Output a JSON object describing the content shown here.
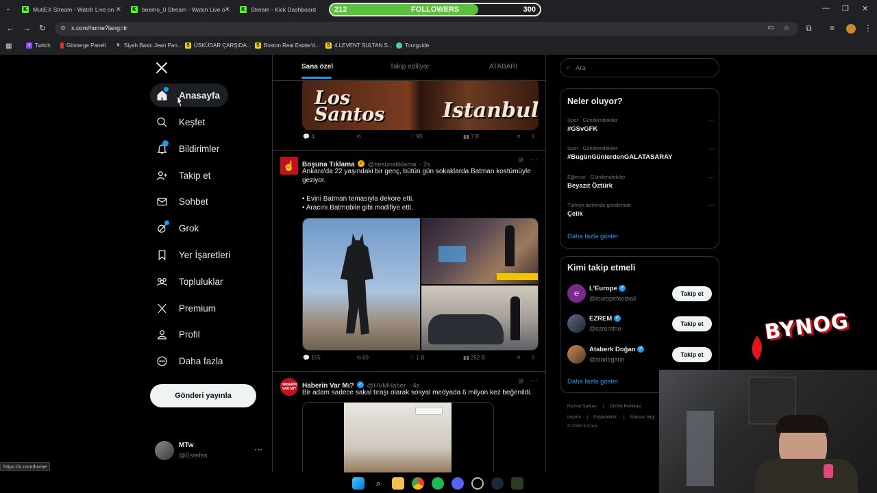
{
  "browser": {
    "tabs": [
      {
        "label": "MutiEX Stream - Watch Live on"
      },
      {
        "label": "beemo_0 Stream - Watch Live o"
      },
      {
        "label": "Stream - Kick Dashboard"
      }
    ],
    "url": "x.com/home?lang=tr",
    "bookmarks": [
      {
        "label": "Twitch"
      },
      {
        "label": "Gösterge Paneli"
      },
      {
        "label": "Siyah Basic Jean Pan..."
      },
      {
        "label": "ÜSKÜDAR ÇARŞIDA..."
      },
      {
        "label": "Boston Real Estate'd..."
      },
      {
        "label": "4.LEVENT SULTAN S..."
      },
      {
        "label": "Tourguide"
      }
    ],
    "status_url": "https://x.com/home"
  },
  "overlay": {
    "followers_current": "212",
    "followers_label": "FOLLOWERS",
    "followers_goal": "300",
    "followers_progress": 0.707,
    "brand_text": "BYNOG"
  },
  "sidebar": {
    "items": [
      {
        "label": "Anasayfa",
        "icon": "home-icon"
      },
      {
        "label": "Keşfet",
        "icon": "search-icon"
      },
      {
        "label": "Bildirimler",
        "icon": "bell-icon"
      },
      {
        "label": "Takip et",
        "icon": "add-user-icon"
      },
      {
        "label": "Sohbet",
        "icon": "mail-icon"
      },
      {
        "label": "Grok",
        "icon": "grok-icon"
      },
      {
        "label": "Yer İşaretleri",
        "icon": "bookmark-icon"
      },
      {
        "label": "Topluluklar",
        "icon": "communities-icon"
      },
      {
        "label": "Premium",
        "icon": "x-logo-icon"
      },
      {
        "label": "Profil",
        "icon": "profile-icon"
      },
      {
        "label": "Daha fazla",
        "icon": "more-icon"
      }
    ],
    "post_button": "Gönderi yayınla",
    "account": {
      "name": "MTw",
      "handle": "@Esrefss"
    }
  },
  "feed": {
    "tabs": [
      "Sana özel",
      "Takip ediliyor",
      "ATABARI"
    ],
    "banner": {
      "left_text": "Los Santos",
      "right_text": "Istanbul"
    },
    "first_actions": {
      "replies": "4",
      "likes": "93",
      "views": "7 B"
    },
    "tweet1": {
      "name": "Boşuna Tıklama",
      "handle": "@bosunatiklama",
      "time": "· 2s",
      "text1": "Ankara'da 22 yaşındaki bir genç, bütün gün sokaklarda Batman kostümüyle geziyor.",
      "bullet1": "• Evini Batman temasıyla dekore etti.",
      "bullet2": "• Aracını Batmobile gibi modifiye etti.",
      "replies": "155",
      "reposts": "60",
      "likes": "1 B",
      "views": "252 B"
    },
    "tweet2": {
      "name": "Haberin Var Mı?",
      "handle": "@HVMHaber",
      "time": "· 4s",
      "text": "Bir adam sadece sakal tıraşı olarak sosyal medyada 6 milyon kez beğenildi.",
      "avatar_text": "HABERİN VAR MI?"
    }
  },
  "right": {
    "search_placeholder": "Ara",
    "trends_title": "Neler oluyor?",
    "trends": [
      {
        "category": "Spor · Gündemdekiler",
        "name": "#GSvGFK"
      },
      {
        "category": "Spor · Gündemdekiler",
        "name": "#BugünGünlerdenGALATASARAY"
      },
      {
        "category": "Eğlence · Gündemdekiler",
        "name": "Beyazıt Öztürk"
      },
      {
        "category": "Türkiye tarihinde gündemde",
        "name": "Çelik"
      }
    ],
    "trends_more": "Daha fazla göster",
    "who_title": "Kimi takip etmeli",
    "who": [
      {
        "name": "L'Europe",
        "handle": "@leuropefootball",
        "button": "Takip et"
      },
      {
        "name": "EZREM",
        "handle": "@ezremthe",
        "button": "Takip et"
      },
      {
        "name": "Ataberk Doğan",
        "handle": "@atadogann",
        "button": "Takip et"
      }
    ],
    "who_more": "Daha fazla göster",
    "footer": [
      "Hizmet Şartları",
      "Gizlilik Politikası",
      "Imprint",
      "Erişilebilirlik",
      "Reklam bilgi",
      "© 2026 X Corp."
    ]
  }
}
